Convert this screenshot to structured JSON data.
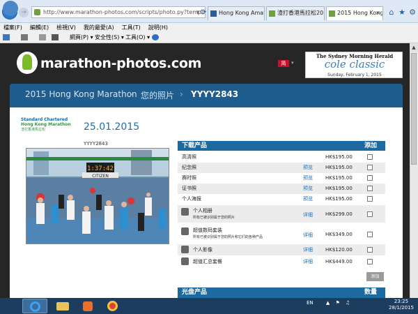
{
  "browser": {
    "address": "http://www.marathon-photos.com/scripts/photo.py?template-",
    "tabs": [
      {
        "label": "Hong Kong Amat..."
      },
      {
        "label": "渣打香港馬拉松20..."
      },
      {
        "label": "2015 Hong Kong ..."
      }
    ],
    "close_glyph": "×",
    "menu": [
      "檔案(F)",
      "編輯(E)",
      "檢視(V)",
      "我的最愛(A)",
      "工具(T)",
      "說明(H)"
    ],
    "commands": {
      "page": "網頁(P) ▾",
      "safety": "安全性(S) ▾",
      "tools": "工具(O) ▾"
    }
  },
  "site": {
    "logo_text": "marathon-photos.com",
    "sponsor": {
      "masthead": "The Sydney Morning Herald",
      "event": "cole classic",
      "date": "Sunday, February 1, 2015"
    }
  },
  "breadcrumb": {
    "event": "2015 Hong Kong Marathon",
    "photos": "您的照片",
    "bib": "YYYY2843"
  },
  "photo_panel": {
    "event_logo": {
      "line1": "Standard Chartered",
      "line2": "Hong Kong Marathon",
      "line3": "渣打香港馬拉松"
    },
    "date": "25.01.2015",
    "bib": "YYYY2843",
    "photo_clock": "1:37:42",
    "photo_sign": "CITIZEN"
  },
  "products": {
    "header": "下载产品",
    "add_header": "添加",
    "rows": [
      {
        "name": "高清照",
        "link": "",
        "price": "HK$195.00"
      },
      {
        "name": "纪念照",
        "link": "预览",
        "price": "HK$195.00"
      },
      {
        "name": "赛时照",
        "link": "预览",
        "price": "HK$195.00"
      },
      {
        "name": "证书照",
        "link": "预览",
        "price": "HK$195.00"
      },
      {
        "name": "个人海报",
        "link": "预览",
        "price": "HK$195.00"
      },
      {
        "name": "个人相册",
        "sub": "所有已被识别属于您的照片",
        "link": "详细",
        "price": "HK$299.00"
      },
      {
        "name": "超值数码套装",
        "sub": "所有已被识别属于您的照片和它们的各种产品",
        "link": "详细",
        "price": "HK$349.00"
      },
      {
        "name": "个人影像",
        "link": "详细",
        "price": "HK$120.00"
      },
      {
        "name": "超值汇总套餐",
        "link": "详细",
        "price": "HK$449.00"
      }
    ],
    "add_button": "添加"
  },
  "disc_products": {
    "header": "光盘产品",
    "qty_header": "数量"
  },
  "taskbar": {
    "lang": "EN",
    "time": "23:25",
    "date": "28/1/2015"
  },
  "colors": {
    "brand_green": "#7bbb2a",
    "header_blue": "#1d6aa0",
    "link_blue": "#1a6fc0"
  }
}
